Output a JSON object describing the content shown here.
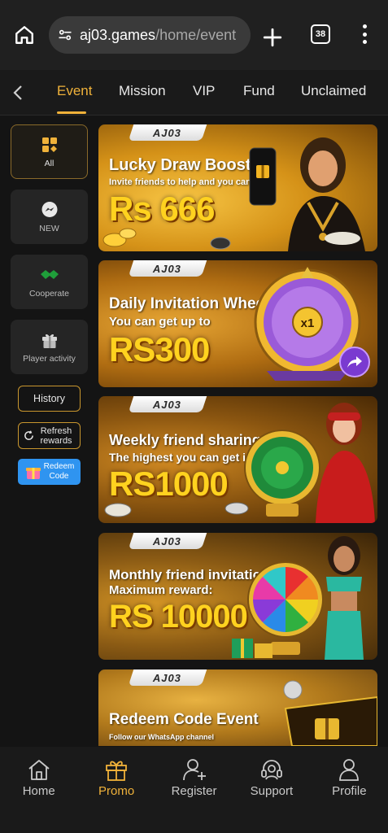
{
  "browser": {
    "url_host": "aj03.games",
    "url_path": "/home/event",
    "tab_count": "38"
  },
  "tabs": [
    {
      "label": "Event",
      "active": true
    },
    {
      "label": "Mission"
    },
    {
      "label": "VIP"
    },
    {
      "label": "Fund"
    },
    {
      "label": "Unclaimed"
    }
  ],
  "sidebar": {
    "categories": [
      {
        "label": "All",
        "icon": "grid-icon",
        "active": true
      },
      {
        "label": "NEW",
        "icon": "messenger-icon"
      },
      {
        "label": "Cooperate",
        "icon": "handshake-icon"
      },
      {
        "label": "Player activity",
        "icon": "gift-icon"
      }
    ],
    "history_label": "History",
    "refresh_label": "Refresh rewards",
    "redeem_line1": "Redeem",
    "redeem_line2": "Code"
  },
  "banners": [
    {
      "logo": "AJ03",
      "title": "Lucky Draw Boost",
      "sub": "Invite friends to help and you can get",
      "amount": "Rs 666"
    },
    {
      "logo": "AJ03",
      "title": "Daily Invitation Wheel",
      "sub": "You can get up to",
      "amount": "RS300",
      "wheel_center": "x1"
    },
    {
      "logo": "AJ03",
      "title": "Weekly friend sharing",
      "sub": "The highest you can get is",
      "amount": "RS1000"
    },
    {
      "logo": "AJ03",
      "title": "Monthly friend invitations",
      "sub": "Maximum reward:",
      "amount": "RS 10000"
    },
    {
      "logo": "AJ03",
      "title": "Redeem Code Event",
      "sub": "Follow our WhatsApp channel"
    }
  ],
  "bottom_nav": [
    {
      "label": "Home",
      "icon": "home-icon"
    },
    {
      "label": "Promo",
      "icon": "gift-icon",
      "active": true
    },
    {
      "label": "Register",
      "icon": "add-user-icon"
    },
    {
      "label": "Support",
      "icon": "headset-icon"
    },
    {
      "label": "Profile",
      "icon": "user-icon"
    }
  ],
  "colors": {
    "accent": "#f0b23a",
    "background": "#141414",
    "redeem_blue": "#2f94f0"
  }
}
